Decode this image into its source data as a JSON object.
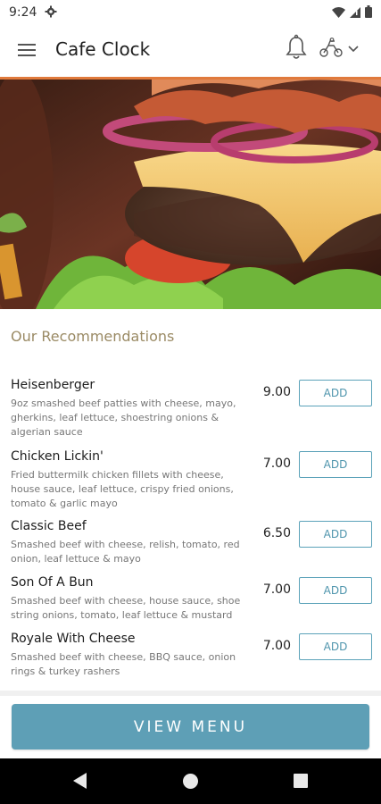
{
  "status_bar": {
    "time": "9:24",
    "icons": [
      "gear-icon",
      "wifi-icon",
      "signal-icon",
      "battery-icon"
    ]
  },
  "app_bar": {
    "title": "Cafe Clock",
    "icons": [
      "hamburger-menu-icon",
      "bell-icon",
      "delivery-rider-icon",
      "chevron-down-icon"
    ],
    "accent_color": "#e07a3c"
  },
  "hero": {
    "image": "burger-photo"
  },
  "recommendations": {
    "title": "Our Recommendations",
    "items": [
      {
        "name": "Heisenberger",
        "description": "9oz smashed beef patties with cheese, mayo, gherkins, leaf lettuce, shoestring onions & algerian sauce",
        "price": "9.00",
        "add_label": "ADD"
      },
      {
        "name": "Chicken Lickin'",
        "description": "Fried buttermilk chicken fillets with cheese, house sauce, leaf lettuce, crispy fried onions, tomato & garlic mayo",
        "price": "7.00",
        "add_label": "ADD"
      },
      {
        "name": "Classic Beef",
        "description": "Smashed beef with cheese, relish, tomato, red onion, leaf lettuce & mayo",
        "price": "6.50",
        "add_label": "ADD"
      },
      {
        "name": "Son Of A Bun",
        "description": "Smashed beef with cheese, house sauce, shoe string onions, tomato, leaf lettuce & mustard",
        "price": "7.00",
        "add_label": "ADD"
      },
      {
        "name": "Royale With Cheese",
        "description": "Smashed beef with cheese, BBQ sauce, onion rings & turkey rashers",
        "price": "7.00",
        "add_label": "ADD"
      }
    ]
  },
  "footer": {
    "view_menu_label": "VIEW MENU",
    "button_color": "#5e9fb6"
  },
  "nav_bar": {
    "icons": [
      "back-icon",
      "home-icon",
      "recents-icon"
    ]
  }
}
